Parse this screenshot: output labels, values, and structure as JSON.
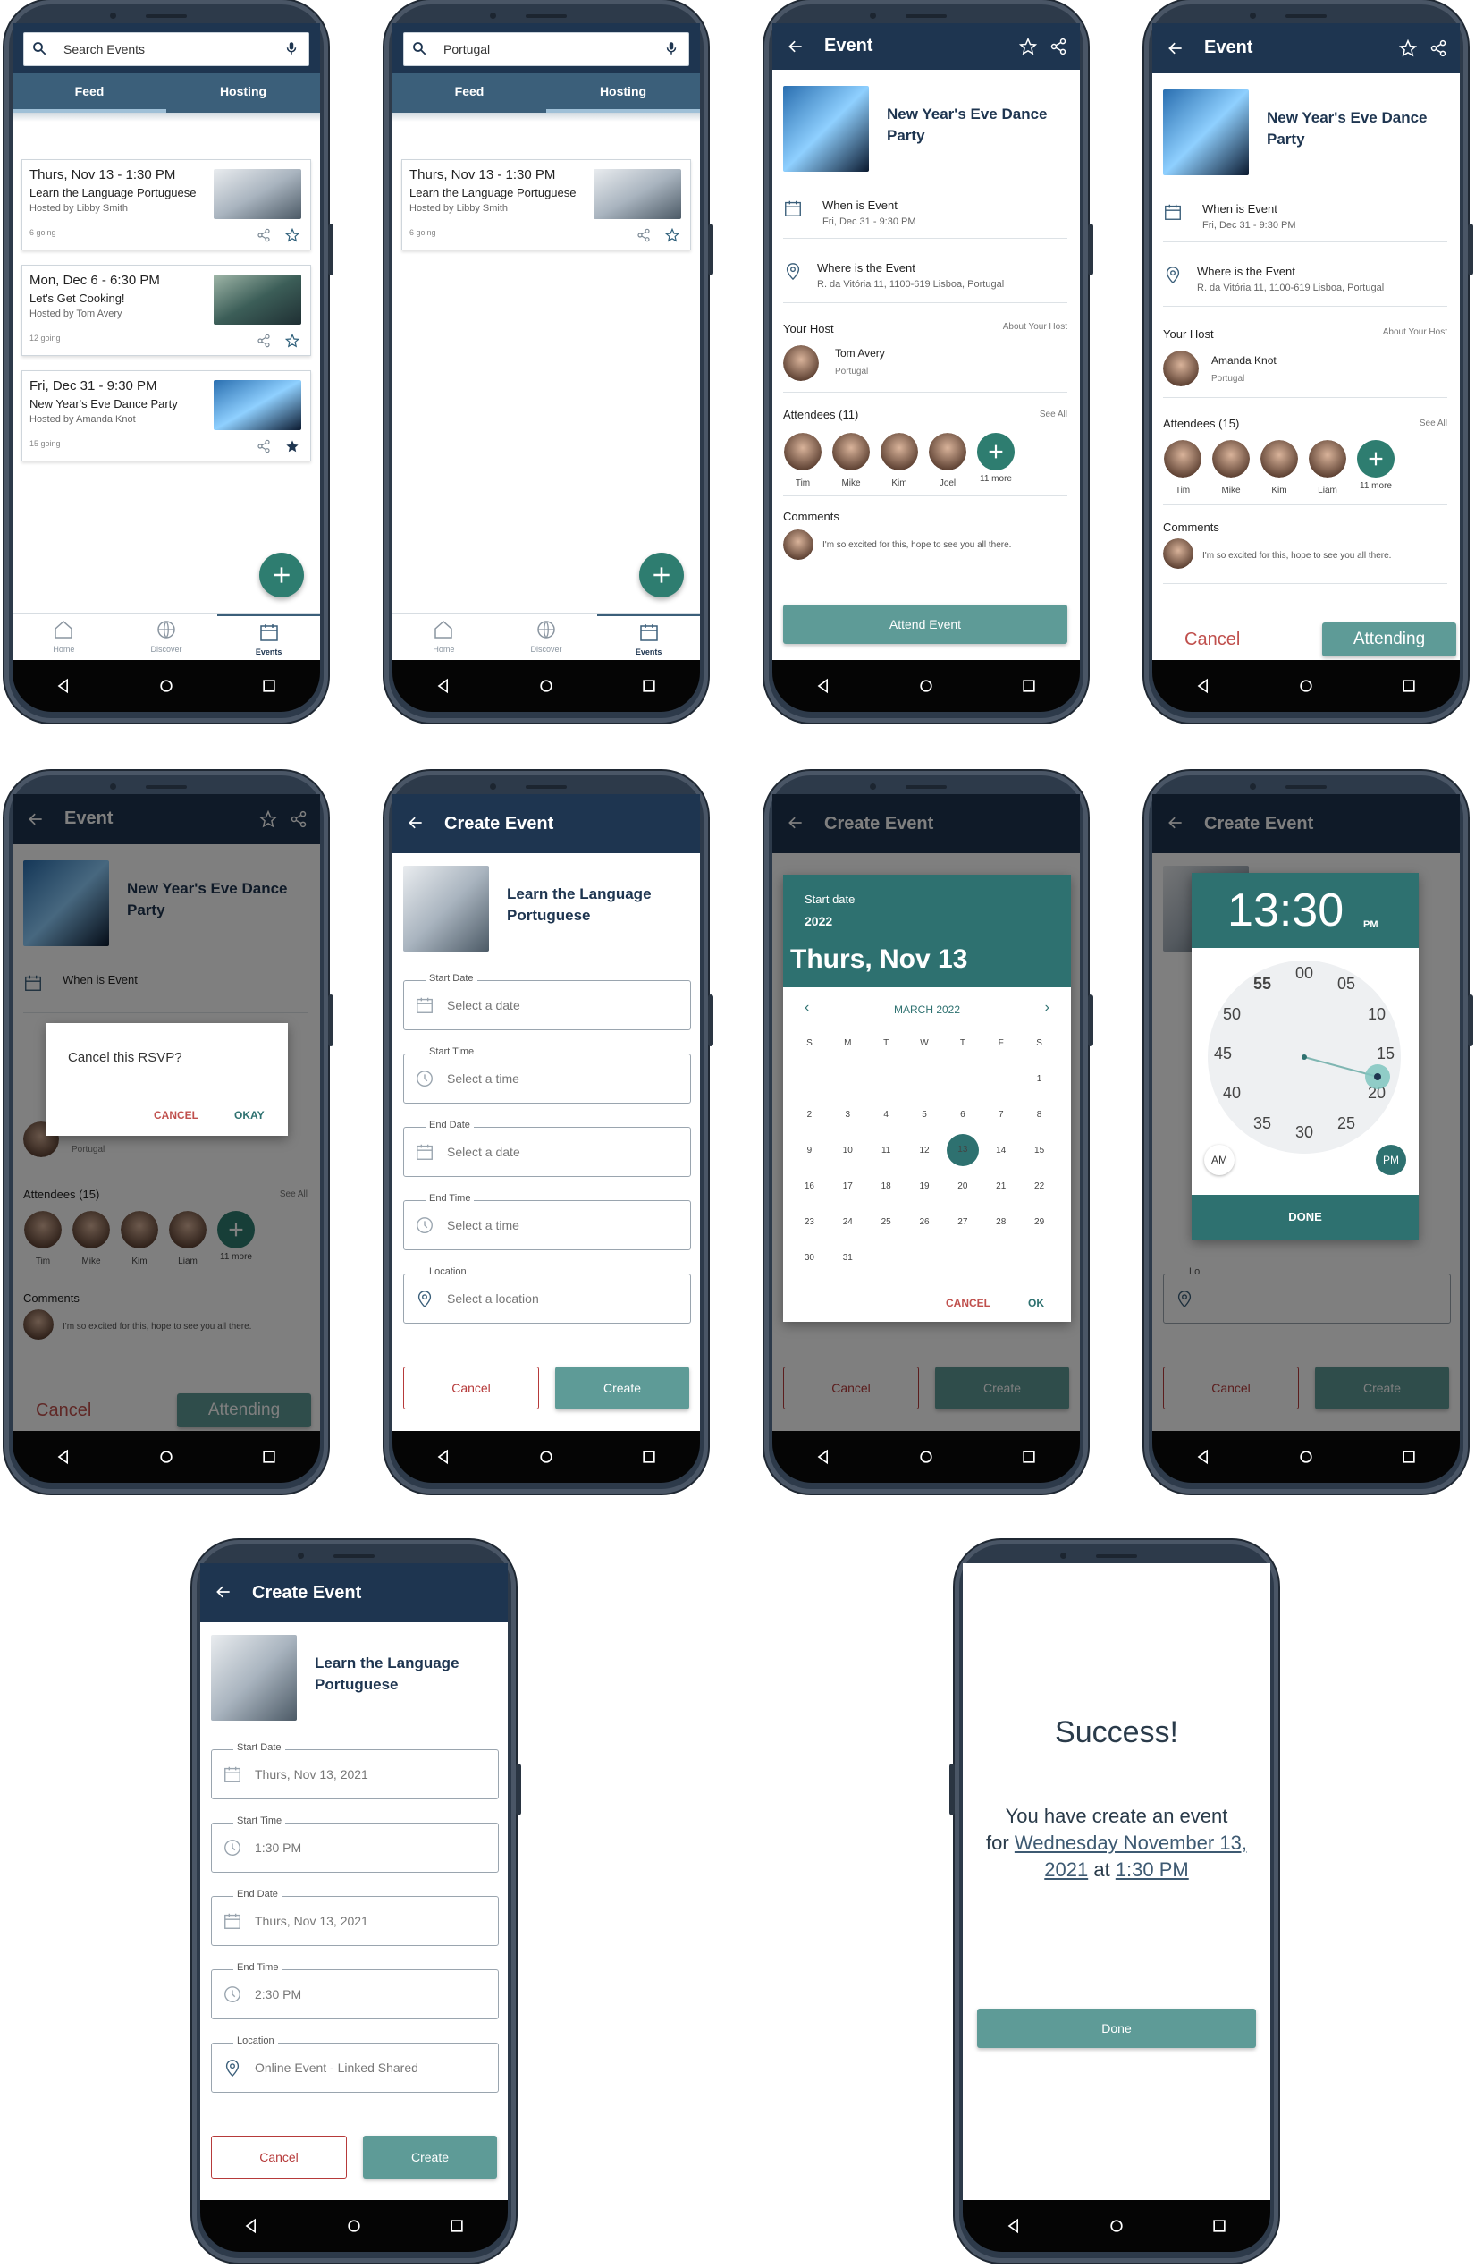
{
  "colors": {
    "navy": "#1e3550",
    "tab_bar": "#3b5f7a",
    "teal": "#2e7d70",
    "teal_btn": "#5e9b97",
    "red": "#c0504d"
  },
  "feed": {
    "search_placeholder": "Search Events",
    "search_value": "Portugal",
    "tabs": [
      "Feed",
      "Hosting"
    ],
    "cards": [
      {
        "date": "Thurs, Nov 13 - 1:30 PM",
        "title": "Learn the Language Portuguese",
        "host": "Hosted by Libby Smith",
        "going": "6 going"
      },
      {
        "date": "Mon, Dec 6 - 6:30 PM",
        "title": "Let's Get Cooking!",
        "host": "Hosted by Tom Avery",
        "going": "12 going"
      },
      {
        "date": "Fri, Dec 31 - 9:30 PM",
        "title": "New Year's Eve Dance Party",
        "host": "Hosted by Amanda Knot",
        "going": "15 going"
      }
    ],
    "bottom_nav": [
      "Home",
      "Discover",
      "Events"
    ]
  },
  "event": {
    "appbar_title": "Event",
    "title": "New Year's Eve Dance Party",
    "when_label": "When is Event",
    "when_value": "Fri, Dec 31 - 9:30 PM",
    "where_label": "Where is the Event",
    "where_value": "R. da Vitória 11, 1100-619 Lisboa, Portugal",
    "host_label": "Your Host",
    "host_link": "About Your Host",
    "host1_name": "Tom Avery",
    "host2_name": "Amanda Knot",
    "host_country": "Portugal",
    "attendees_label_1": "Attendees (11)",
    "attendees_label_2": "Attendees (15)",
    "see_all": "See All",
    "attendees_1": [
      "Tim",
      "Mike",
      "Kim",
      "Joel",
      "11 more"
    ],
    "attendees_2": [
      "Tim",
      "Mike",
      "Kim",
      "Liam",
      "11 more"
    ],
    "comments_label": "Comments",
    "comment": "I'm so excited for this, hope to see you all there.",
    "attend_button": "Attend Event",
    "cancel_label": "Cancel",
    "attending_label": "Attending",
    "dialog_text": "Cancel this RSVP?",
    "dialog_cancel": "CANCEL",
    "dialog_okay": "OKAY"
  },
  "create": {
    "appbar_title": "Create Event",
    "event_title": "Learn the Language Portuguese",
    "fields": [
      {
        "label": "Start Date",
        "placeholder": "Select a date",
        "filled": "Thurs, Nov 13, 2021"
      },
      {
        "label": "Start Time",
        "placeholder": "Select a time",
        "filled": "1:30 PM"
      },
      {
        "label": "End Date",
        "placeholder": "Select a date",
        "filled": "Thurs, Nov 13, 2021"
      },
      {
        "label": "End Time",
        "placeholder": "Select a time",
        "filled": "2:30 PM"
      },
      {
        "label": "Location",
        "placeholder": "Select a location",
        "filled": "Online Event - Linked Shared"
      }
    ],
    "cancel_button": "Cancel",
    "create_button": "Create"
  },
  "datepicker": {
    "label": "Start date",
    "year": "2022",
    "date": "Thurs, Nov 13",
    "month": "MARCH 2022",
    "weekdays": [
      "S",
      "M",
      "T",
      "W",
      "T",
      "F",
      "S"
    ],
    "weeks": [
      [
        "",
        "",
        "",
        "",
        "",
        "",
        "1"
      ],
      [
        "2",
        "3",
        "4",
        "5",
        "6",
        "7",
        "8"
      ],
      [
        "9",
        "10",
        "11",
        "12",
        "13",
        "14",
        "15"
      ],
      [
        "16",
        "17",
        "18",
        "19",
        "20",
        "21",
        "22"
      ],
      [
        "23",
        "24",
        "25",
        "26",
        "27",
        "28",
        "29"
      ],
      [
        "30",
        "31",
        "",
        "",
        "",
        "",
        ""
      ]
    ],
    "selected": "13",
    "cancel": "CANCEL",
    "ok": "OK"
  },
  "timepicker": {
    "time": "13:30",
    "ampm": "PM",
    "numbers": [
      "00",
      "05",
      "10",
      "15",
      "20",
      "25",
      "30",
      "35",
      "40",
      "45",
      "50",
      "55"
    ],
    "am": "AM",
    "pm": "PM",
    "done": "DONE",
    "field_label_short": "Lo",
    "title_fragment": "Learn the Language"
  },
  "success": {
    "heading": "Success!",
    "line1": "You have create an event",
    "for_word": "for",
    "date_link": "Wednesday November 13, 2021",
    "at_word": "at",
    "time_link": "1:30 PM",
    "done_button": "Done"
  }
}
